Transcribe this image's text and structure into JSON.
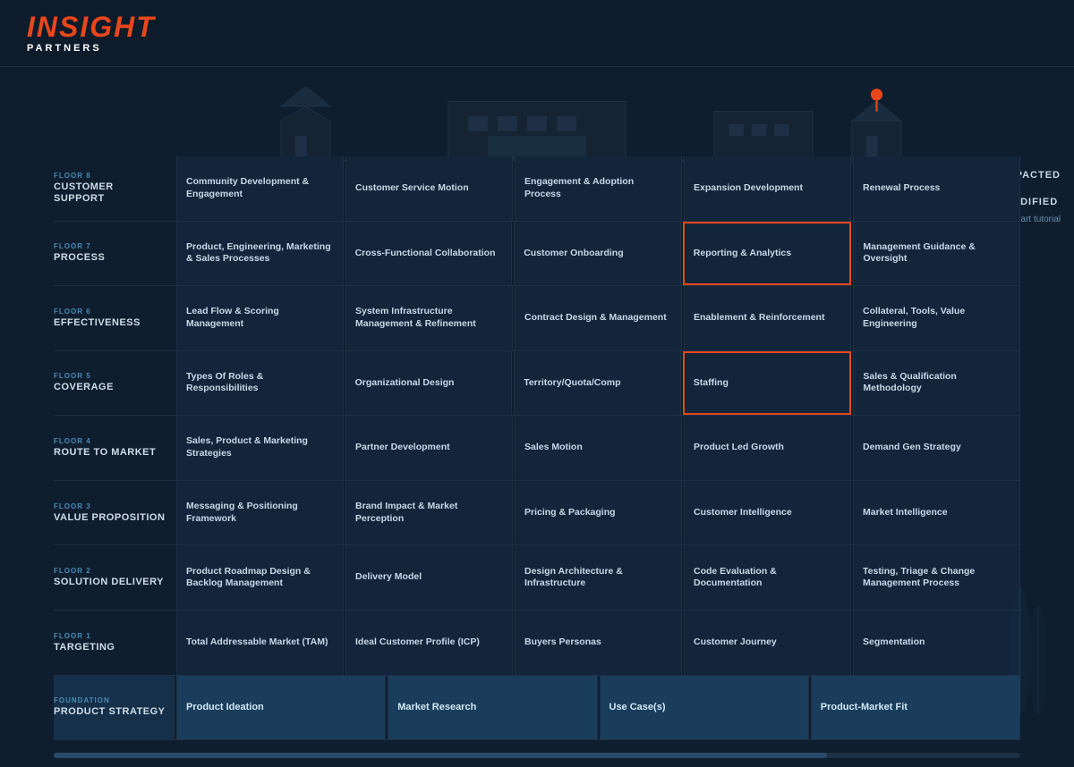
{
  "header": {
    "logo_insight": "INSIGHT",
    "logo_partners": "PARTNERS"
  },
  "legend": {
    "impacted_label": "IMPACTED",
    "modified_label": "MODIFIED",
    "restart_label": "Restart tutorial"
  },
  "floors": [
    {
      "id": "floor8",
      "number": "FLOOR 8",
      "name": "CUSTOMER SUPPORT",
      "cells": [
        "Community Development & Engagement",
        "Customer Service Motion",
        "Engagement & Adoption Process",
        "Expansion Development",
        "Renewal Process"
      ],
      "highlights": {}
    },
    {
      "id": "floor7",
      "number": "FLOOR 7",
      "name": "PROCESS",
      "cells": [
        "Product, Engineering, Marketing & Sales Processes",
        "Cross-Functional Collaboration",
        "Customer Onboarding",
        "Reporting & Analytics",
        "Management Guidance & Oversight"
      ],
      "highlights": {
        "3": "orange"
      }
    },
    {
      "id": "floor6",
      "number": "FLOOR 6",
      "name": "EFFECTIVENESS",
      "cells": [
        "Lead Flow & Scoring Management",
        "System Infrastructure Management & Refinement",
        "Contract Design & Management",
        "Enablement & Reinforcement",
        "Collateral, Tools, Value Engineering"
      ],
      "highlights": {}
    },
    {
      "id": "floor5",
      "number": "FLOOR 5",
      "name": "COVERAGE",
      "cells": [
        "Types Of Roles & Responsibilities",
        "Organizational Design",
        "Territory/Quota/Comp",
        "Staffing",
        "Sales & Qualification Methodology"
      ],
      "highlights": {
        "3": "orange"
      }
    },
    {
      "id": "floor4",
      "number": "FLOOR 4",
      "name": "ROUTE TO MARKET",
      "cells": [
        "Sales, Product & Marketing Strategies",
        "Partner Development",
        "Sales Motion",
        "Product Led Growth",
        "Demand Gen Strategy"
      ],
      "highlights": {}
    },
    {
      "id": "floor3",
      "number": "FLOOR 3",
      "name": "VALUE PROPOSITION",
      "cells": [
        "Messaging & Positioning Framework",
        "Brand Impact & Market Perception",
        "Pricing & Packaging",
        "Customer Intelligence",
        "Market Intelligence"
      ],
      "highlights": {}
    },
    {
      "id": "floor2",
      "number": "FLOOR 2",
      "name": "SOLUTION DELIVERY",
      "cells": [
        "Product Roadmap Design & Backlog Management",
        "Delivery Model",
        "Design Architecture & Infrastructure",
        "Code Evaluation & Documentation",
        "Testing, Triage & Change Management Process"
      ],
      "highlights": {}
    },
    {
      "id": "floor1",
      "number": "FLOOR 1",
      "name": "TARGETING",
      "cells": [
        "Total Addressable Market (TAM)",
        "Ideal Customer Profile (ICP)",
        "Buyers Personas",
        "Customer Journey",
        "Segmentation"
      ],
      "highlights": {}
    },
    {
      "id": "foundation",
      "number": "FOUNDATION",
      "name": "PRODUCT STRATEGY",
      "cells": [
        "Product Ideation",
        "Market Research",
        "Use Case(s)",
        "Product-Market Fit",
        ""
      ],
      "highlights": {},
      "isFoundation": true
    }
  ]
}
